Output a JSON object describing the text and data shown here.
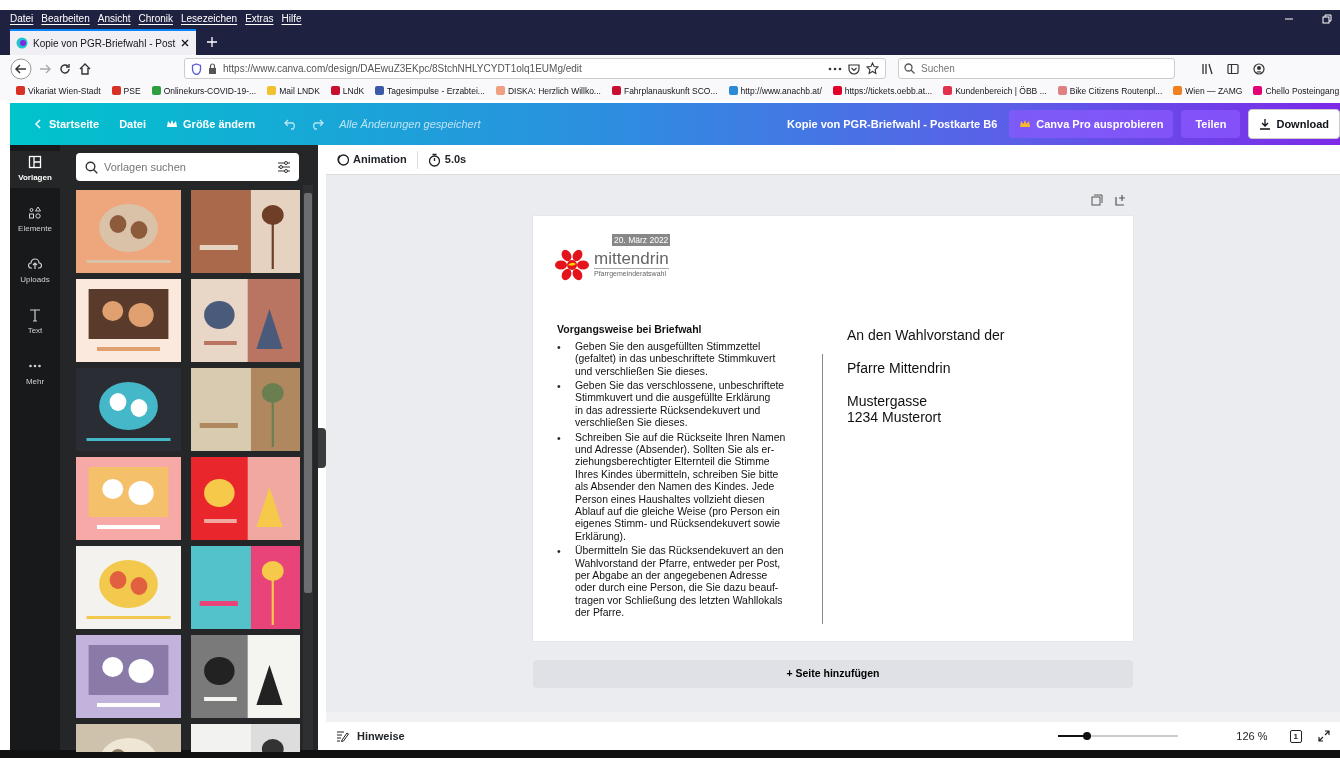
{
  "browser": {
    "menu": [
      "Datei",
      "Bearbeiten",
      "Ansicht",
      "Chronik",
      "Lesezeichen",
      "Extras",
      "Hilfe"
    ],
    "tab": {
      "title": "Kopie von PGR-Briefwahl - Post",
      "selected": true
    },
    "url": "https://www.canva.com/design/DAEwuZ3EKpc/8StchNHLYCYDT1olq1EUMg/edit",
    "search": {
      "placeholder": "Suchen"
    },
    "bookmarks": [
      {
        "label": "Vikariat Wien-Stadt",
        "color": "#d93025"
      },
      {
        "label": "PSE",
        "color": "#d93025"
      },
      {
        "label": "Onlinekurs-COVID-19-...",
        "color": "#2e9e3e"
      },
      {
        "label": "Mail LNDK",
        "color": "#f2c12e"
      },
      {
        "label": "LNdK",
        "color": "#c8102e"
      },
      {
        "label": "Tagesimpulse - Erzabtei...",
        "color": "#3a5aa8"
      },
      {
        "label": "DISKA: Herzlich Willko...",
        "color": "#f0a080"
      },
      {
        "label": "Fahrplanauskunft SCO...",
        "color": "#c8102e"
      },
      {
        "label": "http://www.anachb.at/",
        "color": "#2a8ad4"
      },
      {
        "label": "https://tickets.oebb.at...",
        "color": "#e2002a"
      },
      {
        "label": "Kundenbereich | ÖBB ...",
        "color": "#e0304a"
      },
      {
        "label": "Bike Citizens Routenpl...",
        "color": "#e08080"
      },
      {
        "label": "Wien — ZAMG",
        "color": "#f08020"
      },
      {
        "label": "Chello Posteingang",
        "color": "#e20074"
      }
    ]
  },
  "topbar": {
    "home": "Startseite",
    "file": "Datei",
    "resize": "Größe ändern",
    "status": "Alle Änderungen gespeichert",
    "title": "Kopie von PGR-Briefwahl - Postkarte B6",
    "pro": "Canva Pro ausprobieren",
    "share": "Teilen",
    "download": "Download"
  },
  "rail": [
    {
      "label": "Vorlagen",
      "selected": true,
      "kind": "templates"
    },
    {
      "label": "Elemente",
      "selected": false,
      "kind": "elements"
    },
    {
      "label": "Uploads",
      "selected": false,
      "kind": "uploads"
    },
    {
      "label": "Text",
      "selected": false,
      "kind": "text"
    },
    {
      "label": "Mehr",
      "selected": false,
      "kind": "more"
    }
  ],
  "panel": {
    "search": {
      "placeholder": "Vorlagen suchen"
    }
  },
  "toolbar": {
    "animation": "Animation",
    "duration": "5.0s"
  },
  "postcard": {
    "date": "20. März 2022",
    "logo": "mittendrin",
    "logo_sub": "Pfarrgemeinderatswahl",
    "heading": "Vorgangsweise bei Briefwahl",
    "bullet_mark": "•",
    "bullets": [
      "Geben Sie den ausgefüllten Stimmzettel\n(gefaltet) in das unbeschriftete Stimmkuvert\nund verschließen Sie dieses.",
      "Geben Sie das verschlossene, unbeschriftete\nStimmkuvert und die ausgefüllte Erklärung\nin das adressierte Rücksendekuvert und\nverschließen Sie dieses.",
      "Schreiben Sie auf die Rückseite Ihren Namen\nund Adresse (Absender). Sollten Sie als er-\nziehungsberechtigter Elternteil die Stimme\nIhres Kindes übermitteln, schreiben Sie bitte\nals Absender den Namen des Kindes. Jede\nPerson eines Haushaltes vollzieht diesen\nAblauf auf die gleiche Weise (pro Person ein\neigenes Stimm- und Rücksendekuvert sowie\nErklärung).",
      "Übermitteln Sie das Rücksendekuvert an den\nWahlvorstand der Pfarre, entweder per Post,\nper Abgabe an der angegebenen Adresse\noder durch eine Person, die Sie dazu beauf-\ntragen vor Schließung des letzten Wahllokals\nder Pfarre."
    ],
    "address": [
      "An den Wahlvorstand der",
      "Pfarre Mittendrin",
      "Mustergasse\n1234 Musterort"
    ]
  },
  "add_page": "+ Seite hinzufügen",
  "bottom": {
    "notes": "Hinweise",
    "zoom": {
      "level": 0.24
    },
    "zoom_reading": "126 %",
    "page": "1"
  }
}
